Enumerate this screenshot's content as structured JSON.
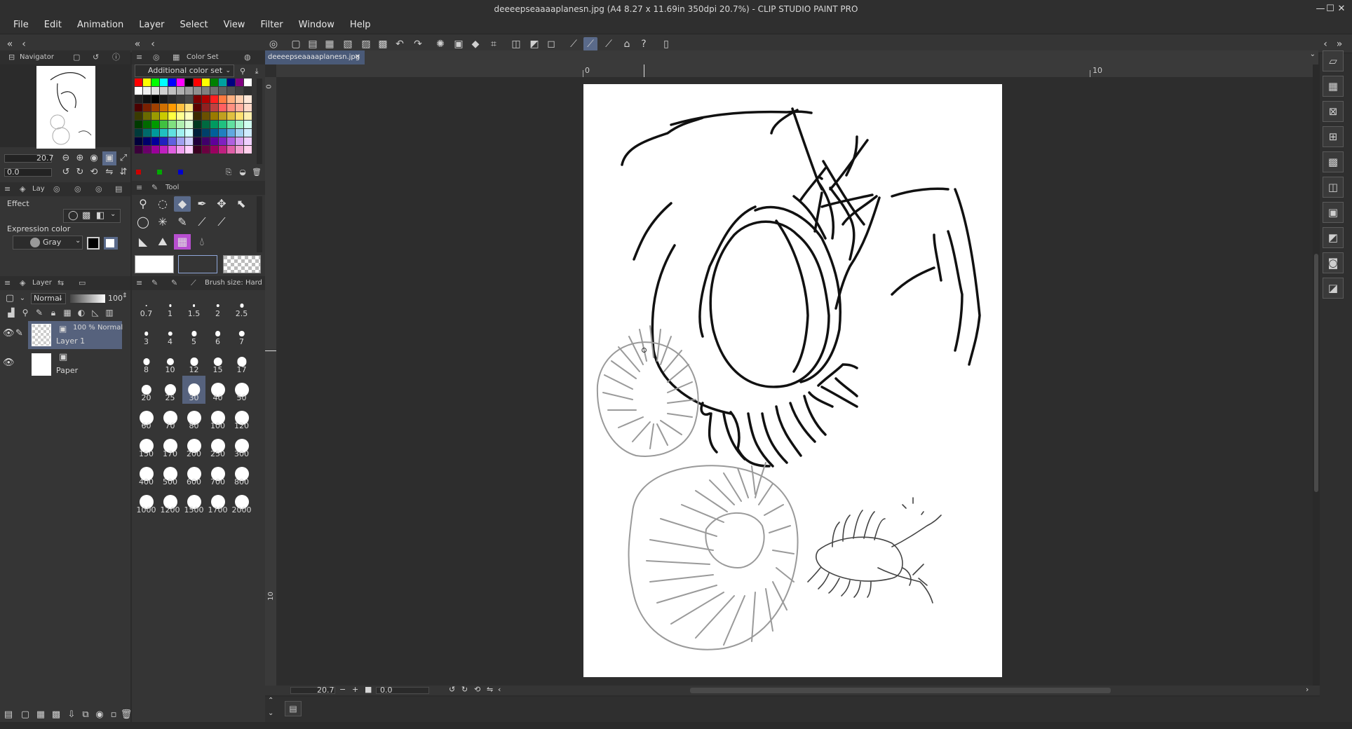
{
  "window": {
    "title": "deeeepseaaaaplanesn.jpg (A4 8.27 x 11.69in 350dpi 20.7%)  - CLIP STUDIO PAINT PRO",
    "minimize": "—",
    "maximize": "☐",
    "close": "✕"
  },
  "menu": [
    "File",
    "Edit",
    "Animation",
    "Layer",
    "Select",
    "View",
    "Filter",
    "Window",
    "Help"
  ],
  "navigator": {
    "tab_label": "Navigator",
    "zoom": "20.7",
    "rotation": "0.0"
  },
  "color_set": {
    "tab_label": "Color Set",
    "selected_set": "Additional color set",
    "rows": [
      [
        "#ff0000",
        "#ffff00",
        "#00ff00",
        "#00ffff",
        "#0000ff",
        "#ff00ff",
        "#000000",
        "#ff0000",
        "#ffff00",
        "#008000",
        "#00a0a0",
        "#000080",
        "#800080",
        "#ffffff"
      ],
      [
        "#ffffff",
        "#f0f0f0",
        "#e0e0e0",
        "#d0d0d0",
        "#c0c0c0",
        "#b0b0b0",
        "#a0a0a0",
        "#909090",
        "#808080",
        "#707070",
        "#606060",
        "#505050",
        "#404040",
        "#303030"
      ],
      [
        "#202020",
        "#101010",
        "#000000",
        "#1a1a1a",
        "#2a2a2a",
        "#3a3a3a",
        "#4a4a4a",
        "#7a0000",
        "#b00000",
        "#ff2020",
        "#ff7a40",
        "#ffb080",
        "#ffd0b0",
        "#ffe8d8"
      ],
      [
        "#4a0000",
        "#7a2000",
        "#a04000",
        "#d07000",
        "#ff9a00",
        "#ffc040",
        "#ffe080",
        "#5a0000",
        "#902020",
        "#c04040",
        "#ff6060",
        "#ff9080",
        "#ffb0a0",
        "#ffd8c8"
      ],
      [
        "#3a3a00",
        "#6a6a00",
        "#9a9a00",
        "#caca00",
        "#ffff40",
        "#ffff90",
        "#ffffc0",
        "#3a2a00",
        "#6a5000",
        "#9a7a00",
        "#c0a020",
        "#e0c040",
        "#ffe070",
        "#fff0b0"
      ],
      [
        "#003a00",
        "#006a00",
        "#009a00",
        "#40c040",
        "#80e080",
        "#b0f0b0",
        "#d8ffd8",
        "#003a20",
        "#006a40",
        "#009a60",
        "#20c080",
        "#60e0a0",
        "#a0f0c8",
        "#d0fff0"
      ],
      [
        "#003a3a",
        "#006a6a",
        "#009a9a",
        "#20c0c0",
        "#60e0e0",
        "#a0f0f0",
        "#d0ffff",
        "#00203a",
        "#00406a",
        "#00609a",
        "#2080c0",
        "#60a8e0",
        "#a0d0f0",
        "#d0ecff"
      ],
      [
        "#00003a",
        "#00006a",
        "#00009a",
        "#2020c0",
        "#6060e0",
        "#a0a0f0",
        "#d0d0ff",
        "#20003a",
        "#40006a",
        "#60009a",
        "#8020c0",
        "#b060e0",
        "#d8a0f0",
        "#f0d0ff"
      ],
      [
        "#3a003a",
        "#6a006a",
        "#9a009a",
        "#c020c0",
        "#e060e0",
        "#f0a0f0",
        "#ffd0ff",
        "#3a0020",
        "#6a0040",
        "#9a0060",
        "#c02080",
        "#e060a8",
        "#f0a0d0",
        "#ffd0ec"
      ]
    ]
  },
  "layer_property": {
    "tab_label": "Lay",
    "effect_label": "Effect",
    "expression_label": "Expression color",
    "expression_value": "Gray"
  },
  "tool": {
    "tab_label": "Tool",
    "icons": [
      "zoom-icon",
      "lasso-select-icon",
      "eraser-icon",
      "pen-icon",
      "move-icon",
      "object-select-icon",
      "lasso-icon",
      "auto-select-icon",
      "pencil-icon",
      "brush-icon",
      "eyedropper-icon",
      "fill-icon",
      "text-icon",
      "gradient-icon",
      "blend-icon"
    ]
  },
  "brush_size": {
    "tab_label": "Brush size: Hard",
    "sizes": [
      "0.7",
      "1",
      "1.5",
      "2",
      "2.5",
      "3",
      "4",
      "5",
      "6",
      "7",
      "8",
      "10",
      "12",
      "15",
      "17",
      "20",
      "25",
      "30",
      "40",
      "50",
      "60",
      "70",
      "80",
      "100",
      "120",
      "150",
      "170",
      "200",
      "250",
      "300",
      "400",
      "500",
      "600",
      "700",
      "800",
      "1000",
      "1200",
      "1500",
      "1700",
      "2000"
    ],
    "selected": "30"
  },
  "layer_panel": {
    "tab_label": "Layer",
    "blend_mode": "Normal",
    "opacity": "100",
    "layers": [
      {
        "mode": "100 % Normal",
        "name": "Layer 1"
      },
      {
        "mode": "",
        "name": "Paper"
      }
    ]
  },
  "document": {
    "tab": "deeeepseaaaaplanesn.jpg",
    "ruler_top": [
      "0",
      "10"
    ],
    "ruler_left": [
      "0",
      "10"
    ],
    "zoom": "20.7",
    "rotation": "0.0"
  }
}
